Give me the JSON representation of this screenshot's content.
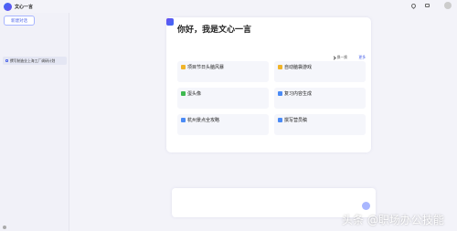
{
  "app": {
    "title": "文心一言"
  },
  "topbar": {
    "link_1": "",
    "link_2": "",
    "link_2_badge": ""
  },
  "sidebar": {
    "new_chat_label": "新建对话",
    "history": [
      {
        "label": "撰写制造业上海工厂调研计划"
      }
    ],
    "footer_label": ""
  },
  "welcome": {
    "greeting": "你好，我是文心一言",
    "intro": "",
    "subheading": "",
    "swap_label": "换一换",
    "more_label": "更多",
    "cards": [
      {
        "title": "项目节日头脑风暴",
        "desc": "",
        "icon": "trophy-icon",
        "color": "#f0b429"
      },
      {
        "title": "自动脑袋游戏",
        "desc": "",
        "icon": "trophy-icon",
        "color": "#f0b429"
      },
      {
        "title": "蛋头像",
        "desc": "",
        "icon": "spark-icon",
        "color": "#3fb950"
      },
      {
        "title": "复习内容生成",
        "desc": "",
        "icon": "doc-icon",
        "color": "#4b8bf5"
      },
      {
        "title": "杭州景点全攻略",
        "desc": "",
        "icon": "compass-icon",
        "color": "#4b8bf5"
      },
      {
        "title": "撰写营员稿",
        "desc": "",
        "icon": "pen-icon",
        "color": "#4b8bf5"
      }
    ]
  },
  "prompt": {
    "tag": "",
    "placeholder": "",
    "footer": ""
  },
  "watermark": "头条 @职场办公技能",
  "colors": {
    "accent": "#4b63e8",
    "background": "#f3f3f9"
  }
}
